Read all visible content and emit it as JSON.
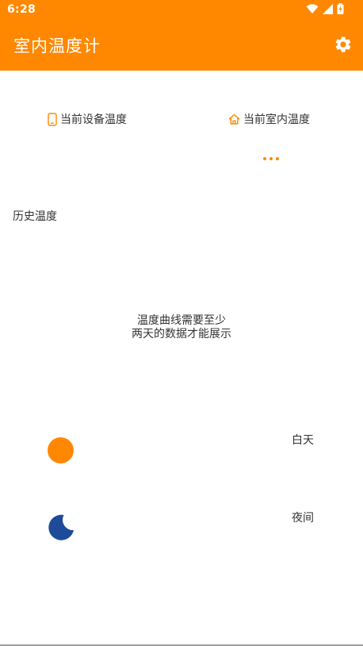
{
  "status_bar": {
    "time": "6:28",
    "icons": [
      "wifi-icon",
      "signal-icon",
      "battery-charging-icon"
    ]
  },
  "app_bar": {
    "title": "室内温度计",
    "settings_icon": "gear-icon",
    "background_color": "#ff8800"
  },
  "current": {
    "device_label": "当前设备温度",
    "device_icon": "phone-icon",
    "indoor_label": "当前室内温度",
    "indoor_icon": "home-icon",
    "indoor_loading_icon": "loading-dots"
  },
  "history": {
    "title": "历史温度",
    "empty_line1": "温度曲线需要至少",
    "empty_line2": "两天的数据才能展示"
  },
  "legend": {
    "day_label": "白天",
    "day_icon": "sun-icon",
    "day_color": "#ff8800",
    "night_label": "夜间",
    "night_icon": "moon-icon",
    "night_color": "#1e4a9a"
  },
  "colors": {
    "accent": "#ff8800",
    "text": "#333333",
    "background": "#ffffff"
  }
}
